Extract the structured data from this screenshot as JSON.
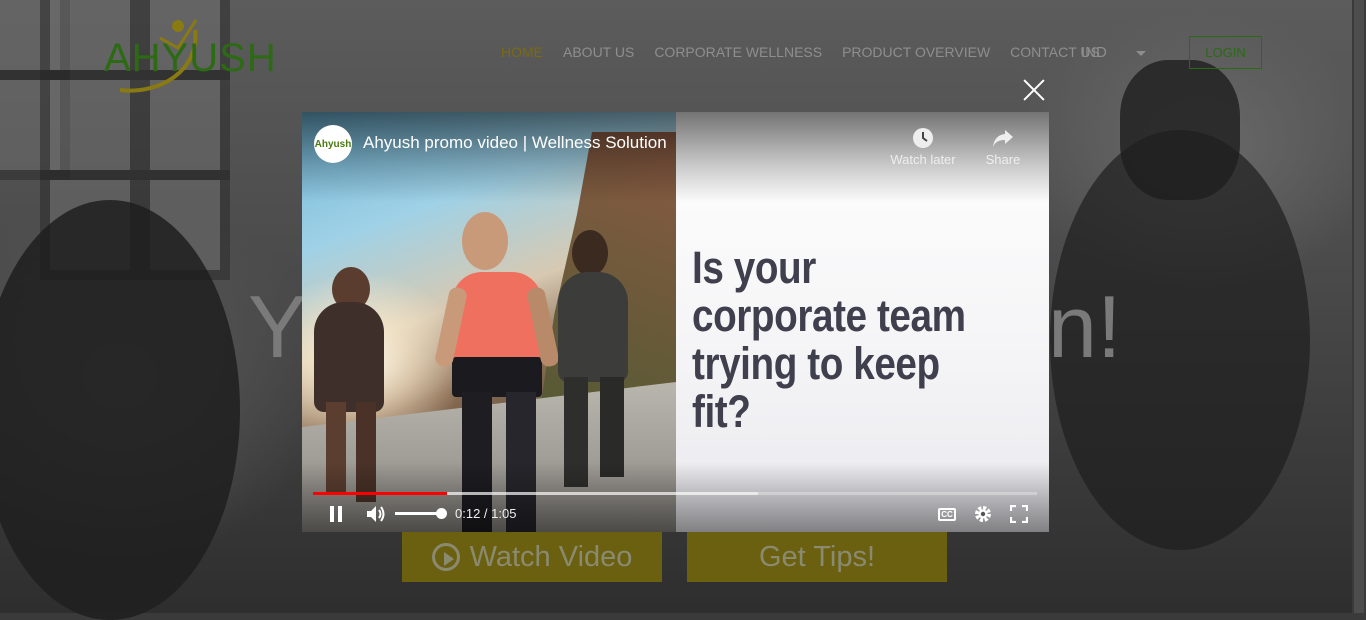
{
  "site": {
    "logo_text": "AHYUSH",
    "nav": [
      {
        "label": "HOME",
        "active": true
      },
      {
        "label": "ABOUT US",
        "active": false
      },
      {
        "label": "CORPORATE WELLNESS",
        "active": false
      },
      {
        "label": "PRODUCT OVERVIEW",
        "active": false
      },
      {
        "label": "CONTACT US",
        "active": false
      }
    ],
    "language": "IND",
    "login_label": "LOGIN",
    "hero_title_start": "Y",
    "hero_title_end": "n!",
    "cta_watch_label": "Watch Video",
    "cta_tips_label": "Get Tips!",
    "accent_color": "#b8a21c",
    "brand_green": "#3f8f1a"
  },
  "video": {
    "channel_avatar_text": "Ahyush",
    "title": "Ahyush promo video | Wellness Solution",
    "watch_later_label": "Watch later",
    "share_label": "Share",
    "headline": "Is your corporate team trying to keep fit?",
    "current_time": "0:12",
    "duration": "1:05",
    "time_display": "0:12 / 1:05",
    "progress_fraction": 0.185,
    "buffered_fraction": 0.615,
    "volume_fraction": 1.0,
    "cc_label": "CC",
    "progress_color": "#ff0000"
  }
}
